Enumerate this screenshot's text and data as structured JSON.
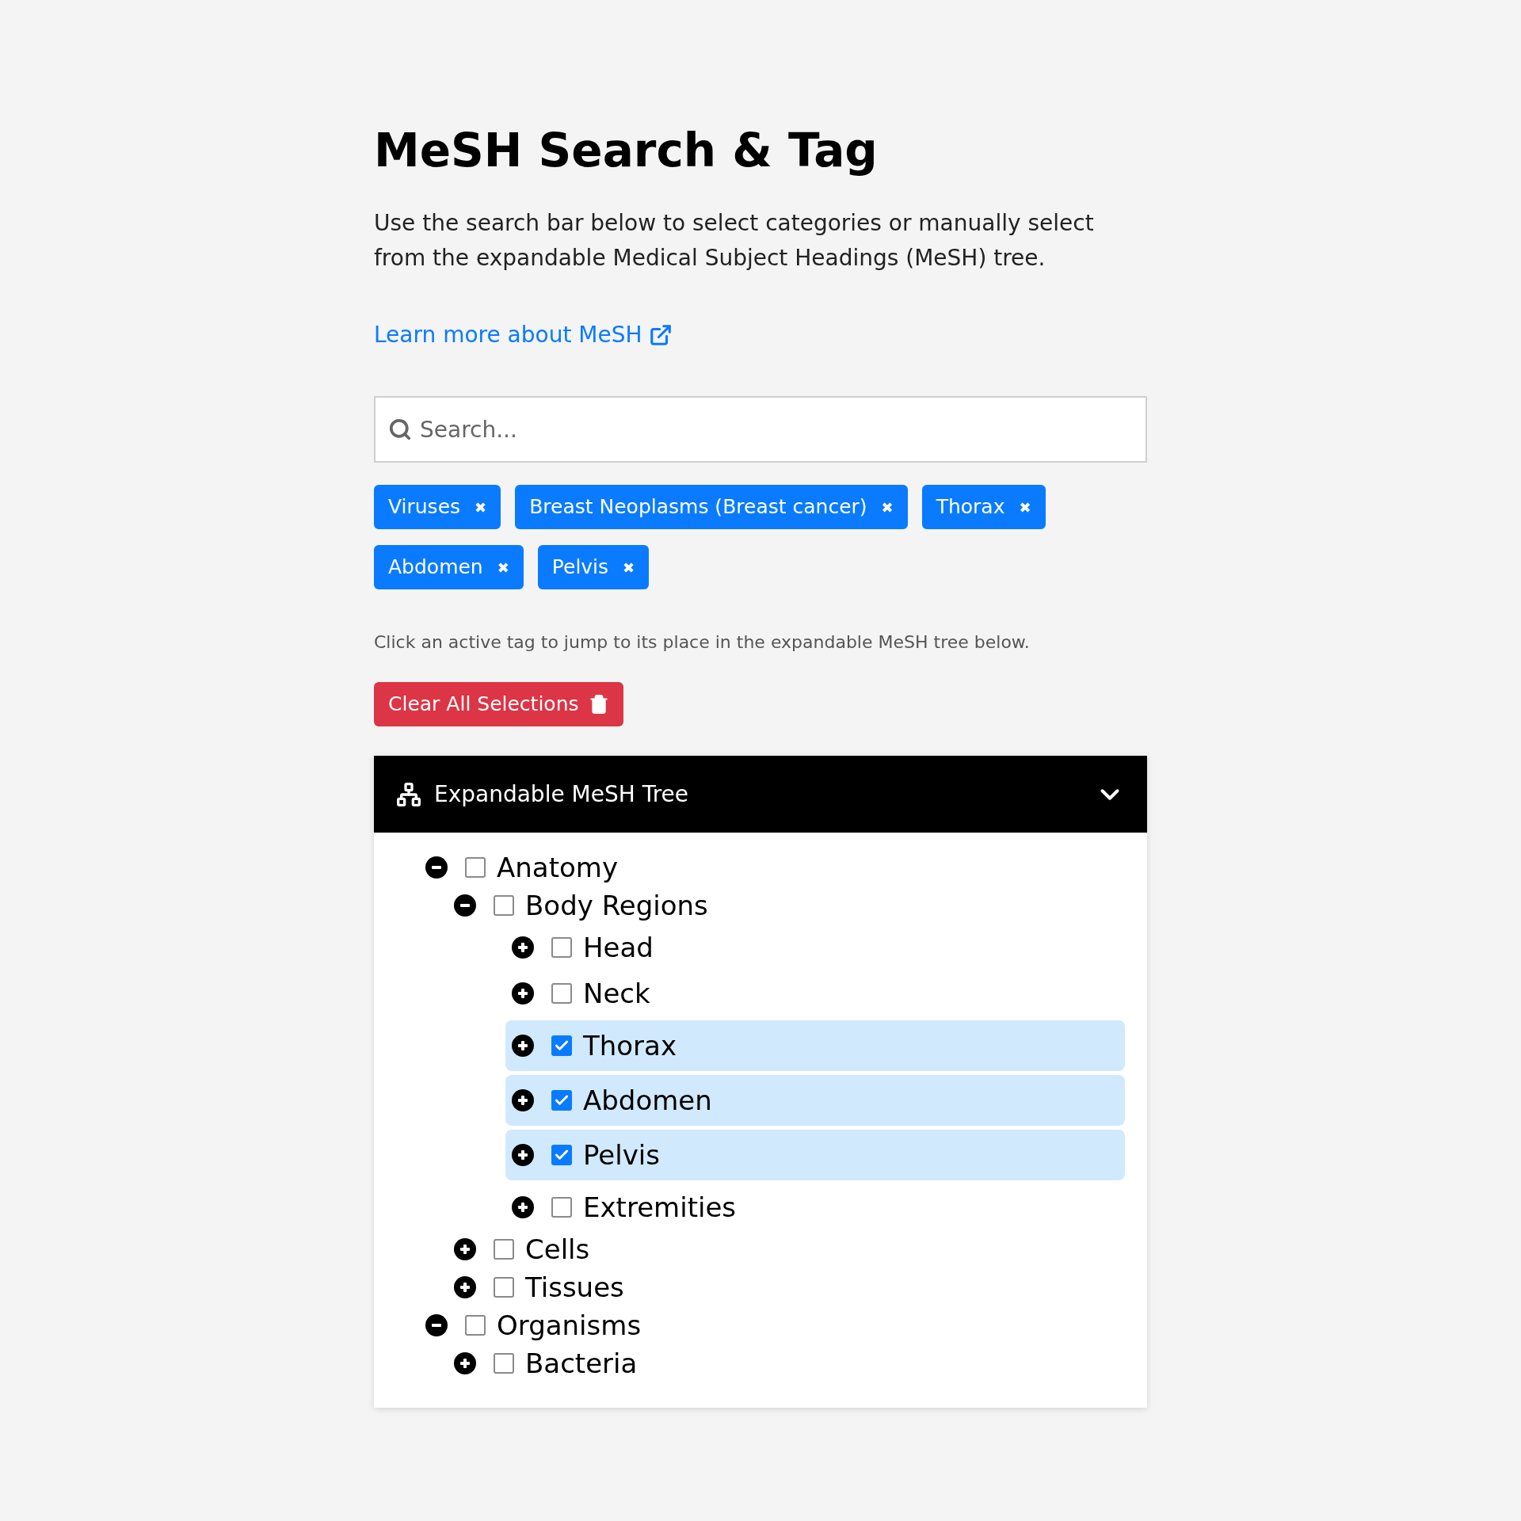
{
  "title": "MeSH Search & Tag",
  "description": "Use the search bar below to select categories or manually select from the expandable Medical Subject Headings (MeSH) tree.",
  "learn_more_link": "Learn more about MeSH",
  "search": {
    "placeholder": "Search..."
  },
  "tags": [
    {
      "label": "Viruses",
      "remove": "✖"
    },
    {
      "label": "Breast Neoplasms (Breast cancer)",
      "remove": "✖"
    },
    {
      "label": "Thorax",
      "remove": "✖"
    },
    {
      "label": "Abdomen",
      "remove": "✖"
    },
    {
      "label": "Pelvis",
      "remove": "✖"
    }
  ],
  "helper_text": "Click an active tag to jump to its place in the expandable MeSH tree below.",
  "clear_button": "Clear All Selections",
  "tree_panel": {
    "title": "Expandable MeSH Tree",
    "expanded": true,
    "items": [
      {
        "label": "Anatomy",
        "expanded": true,
        "checked": false,
        "children": [
          {
            "label": "Body Regions",
            "expanded": true,
            "checked": false,
            "children": [
              {
                "label": "Head",
                "expanded": false,
                "checked": false
              },
              {
                "label": "Neck",
                "expanded": false,
                "checked": false
              },
              {
                "label": "Thorax",
                "expanded": false,
                "checked": true
              },
              {
                "label": "Abdomen",
                "expanded": false,
                "checked": true
              },
              {
                "label": "Pelvis",
                "expanded": false,
                "checked": true
              },
              {
                "label": "Extremities",
                "expanded": false,
                "checked": false
              }
            ]
          },
          {
            "label": "Cells",
            "expanded": false,
            "checked": false
          },
          {
            "label": "Tissues",
            "expanded": false,
            "checked": false
          }
        ]
      },
      {
        "label": "Organisms",
        "expanded": true,
        "checked": false,
        "children": [
          {
            "label": "Bacteria",
            "expanded": false,
            "checked": false
          }
        ]
      }
    ]
  }
}
